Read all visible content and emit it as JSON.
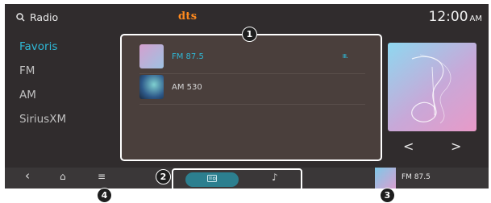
{
  "header": {
    "search_label": "Radio",
    "logo_text": "dts",
    "time": "12:00",
    "ampm": "AM"
  },
  "sidebar": {
    "items": [
      {
        "label": "Favoris",
        "active": true
      },
      {
        "label": "FM",
        "active": false
      },
      {
        "label": "AM",
        "active": false
      },
      {
        "label": "SiriusXM",
        "active": false
      }
    ]
  },
  "stations": [
    {
      "name": "FM 87.5",
      "playing": true
    },
    {
      "name": "AM 530",
      "playing": false
    }
  ],
  "playing_indicator": "ııı.",
  "now_playing": {
    "label": "FM 87.5"
  },
  "bottom_nav": {
    "back": "‹",
    "home": "⌂",
    "menu": "≡"
  },
  "callouts": [
    "1",
    "2",
    "3",
    "4"
  ],
  "colors": {
    "accent": "#2fb8d6",
    "background": "#302c2d",
    "logo": "#ff8a1e",
    "source_pill": "#2c7f8f"
  },
  "icons": {
    "search": "search-icon",
    "radio": "radio-icon",
    "music": "music-icon",
    "prev": "chevron-left-icon",
    "next": "chevron-right-icon"
  }
}
